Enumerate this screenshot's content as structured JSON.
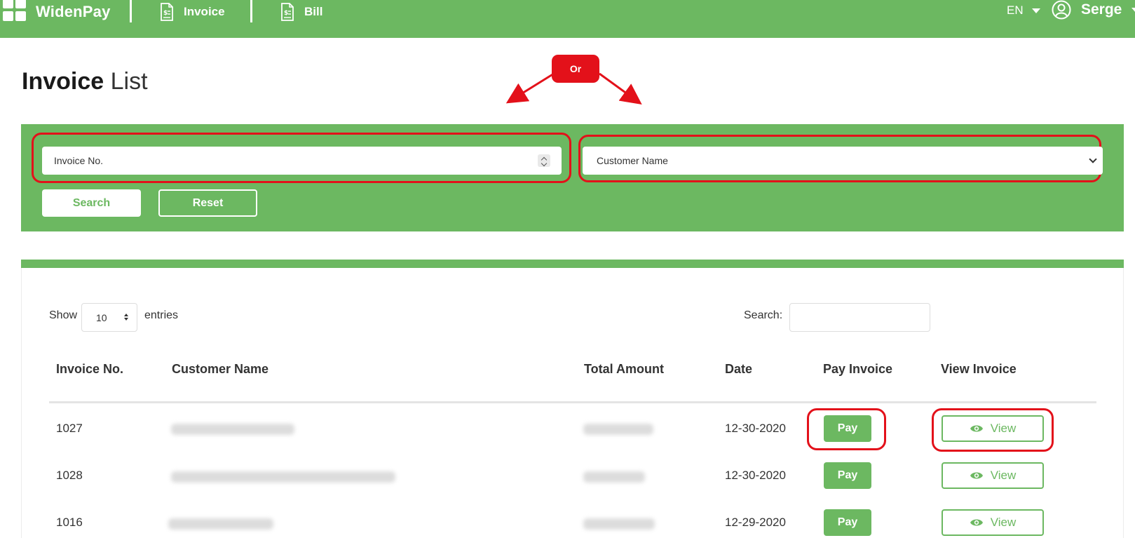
{
  "nav": {
    "brand": "WidenPay",
    "invoice_label": "Invoice",
    "bill_label": "Bill",
    "language": "EN",
    "user_name": "Serge"
  },
  "title": {
    "bold": "Invoice",
    "light": "List"
  },
  "annotation": {
    "or_label": "Or",
    "color": "#e3111a"
  },
  "filters": {
    "invoice_placeholder": "Invoice No.",
    "customer_selected": "Customer Name",
    "search_label": "Search",
    "reset_label": "Reset"
  },
  "table_controls": {
    "show_label": "Show",
    "entries_value": "10",
    "entries_label": "entries",
    "search_label": "Search:"
  },
  "table": {
    "columns": [
      "Invoice No.",
      "Customer Name",
      "Total Amount",
      "Date",
      "Pay Invoice",
      "View Invoice"
    ],
    "rows": [
      {
        "invoice_no": "1027",
        "date": "12-30-2020",
        "pay_label": "Pay",
        "view_label": "View"
      },
      {
        "invoice_no": "1028",
        "date": "12-30-2020",
        "pay_label": "Pay",
        "view_label": "View"
      },
      {
        "invoice_no": "1016",
        "date": "12-29-2020",
        "pay_label": "Pay",
        "view_label": "View"
      }
    ]
  },
  "colors": {
    "brand_green": "#6cb861",
    "highlight_red": "#e3111a"
  }
}
